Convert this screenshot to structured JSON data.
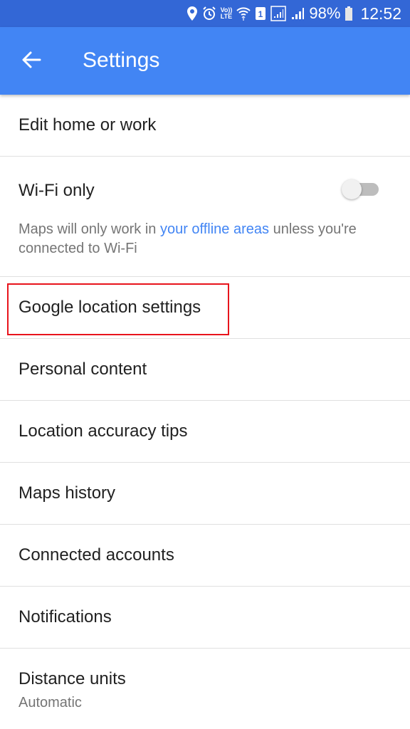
{
  "status_bar": {
    "icons": [
      "location-icon",
      "alarm-icon",
      "volte-icon",
      "wifi-icon",
      "sim-1-icon",
      "signal-sim1-icon",
      "signal-sim2-icon",
      "battery-icon"
    ],
    "volte_label_top": "Vo))",
    "volte_label_bottom": "LTE",
    "sim_label": "1",
    "battery_percent": "98%",
    "time": "12:52"
  },
  "app_bar": {
    "back_icon": "arrow-back-icon",
    "title": "Settings",
    "color": "#4285f4"
  },
  "settings": {
    "edit_home_work": "Edit home or work",
    "wifi_only": {
      "title": "Wi-Fi only",
      "enabled": false,
      "desc_before": "Maps will only work in ",
      "desc_link": "your offline areas",
      "desc_after": " unless you're connected to Wi-Fi"
    },
    "google_location_settings": "Google location settings",
    "personal_content": "Personal content",
    "location_accuracy_tips": "Location accuracy tips",
    "maps_history": "Maps history",
    "connected_accounts": "Connected accounts",
    "notifications": "Notifications",
    "distance_units": {
      "title": "Distance units",
      "value": "Automatic"
    }
  },
  "annotation": {
    "highlighted_item": "Google location settings",
    "color": "#e8141c"
  }
}
